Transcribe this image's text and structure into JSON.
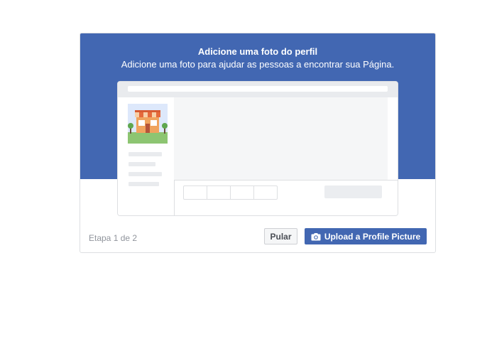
{
  "dialog": {
    "title": "Adicione uma foto do perfil",
    "subtitle": "Adicione uma foto para ajudar as pessoas a encontrar sua Página."
  },
  "footer": {
    "step_text": "Etapa 1 de 2",
    "skip_label": "Pular",
    "upload_label": "Upload a Profile Picture",
    "upload_icon": "camera-icon"
  },
  "colors": {
    "brand_blue": "#4267b2",
    "border": "#dddfe2",
    "muted_text": "#90949c"
  }
}
